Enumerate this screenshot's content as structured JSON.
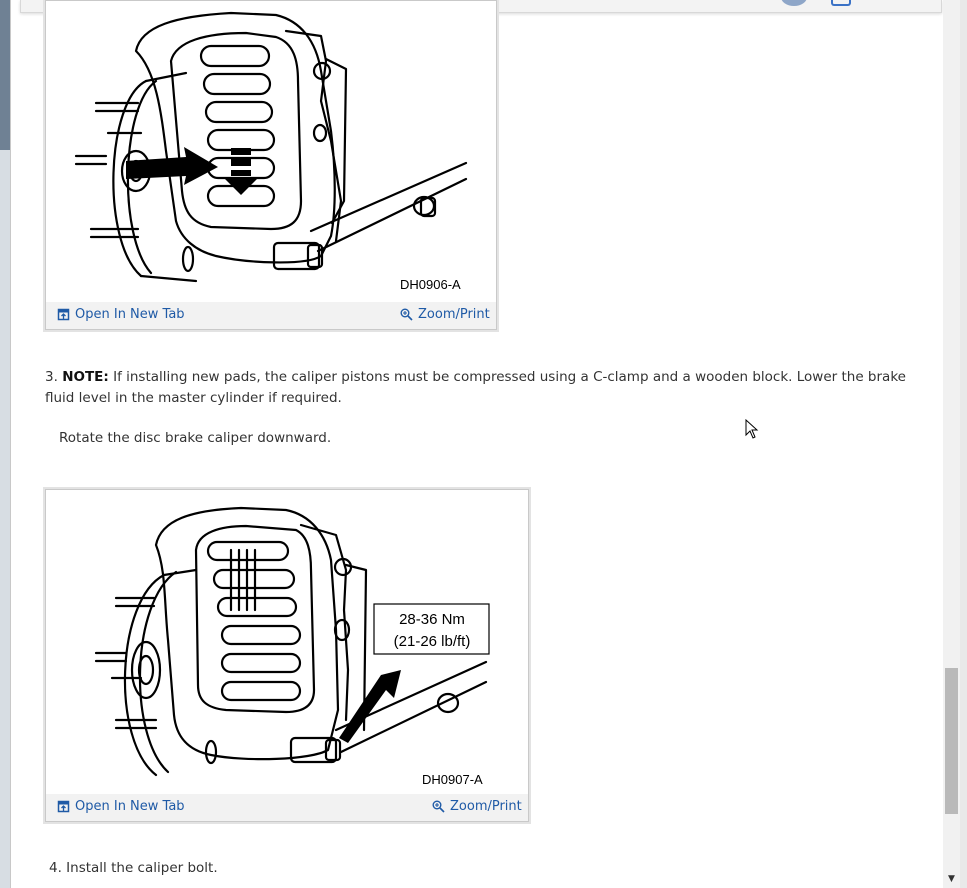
{
  "figures": [
    {
      "code": "DH0906-A",
      "open_label": "Open In New Tab",
      "zoom_label": "Zoom/Print"
    },
    {
      "code": "DH0907-A",
      "open_label": "Open In New Tab",
      "zoom_label": "Zoom/Print",
      "torque_nm": "28-36 Nm",
      "torque_lbft": "(21-26 lb/ft)"
    }
  ],
  "steps": {
    "step3_number": "3.",
    "step3_note_label": "NOTE:",
    "step3_note_text": " If installing new pads, the caliper pistons must be compressed using a C-clamp and a wooden block. Lower the brake fluid level in the master cylinder if required.",
    "step3_action": "Rotate the disc brake caliper downward.",
    "step4": "4. Install the caliper bolt."
  },
  "icons": {
    "open": "open-new-tab-icon",
    "zoom": "zoom-icon",
    "cursor": "mouse-cursor-icon"
  }
}
